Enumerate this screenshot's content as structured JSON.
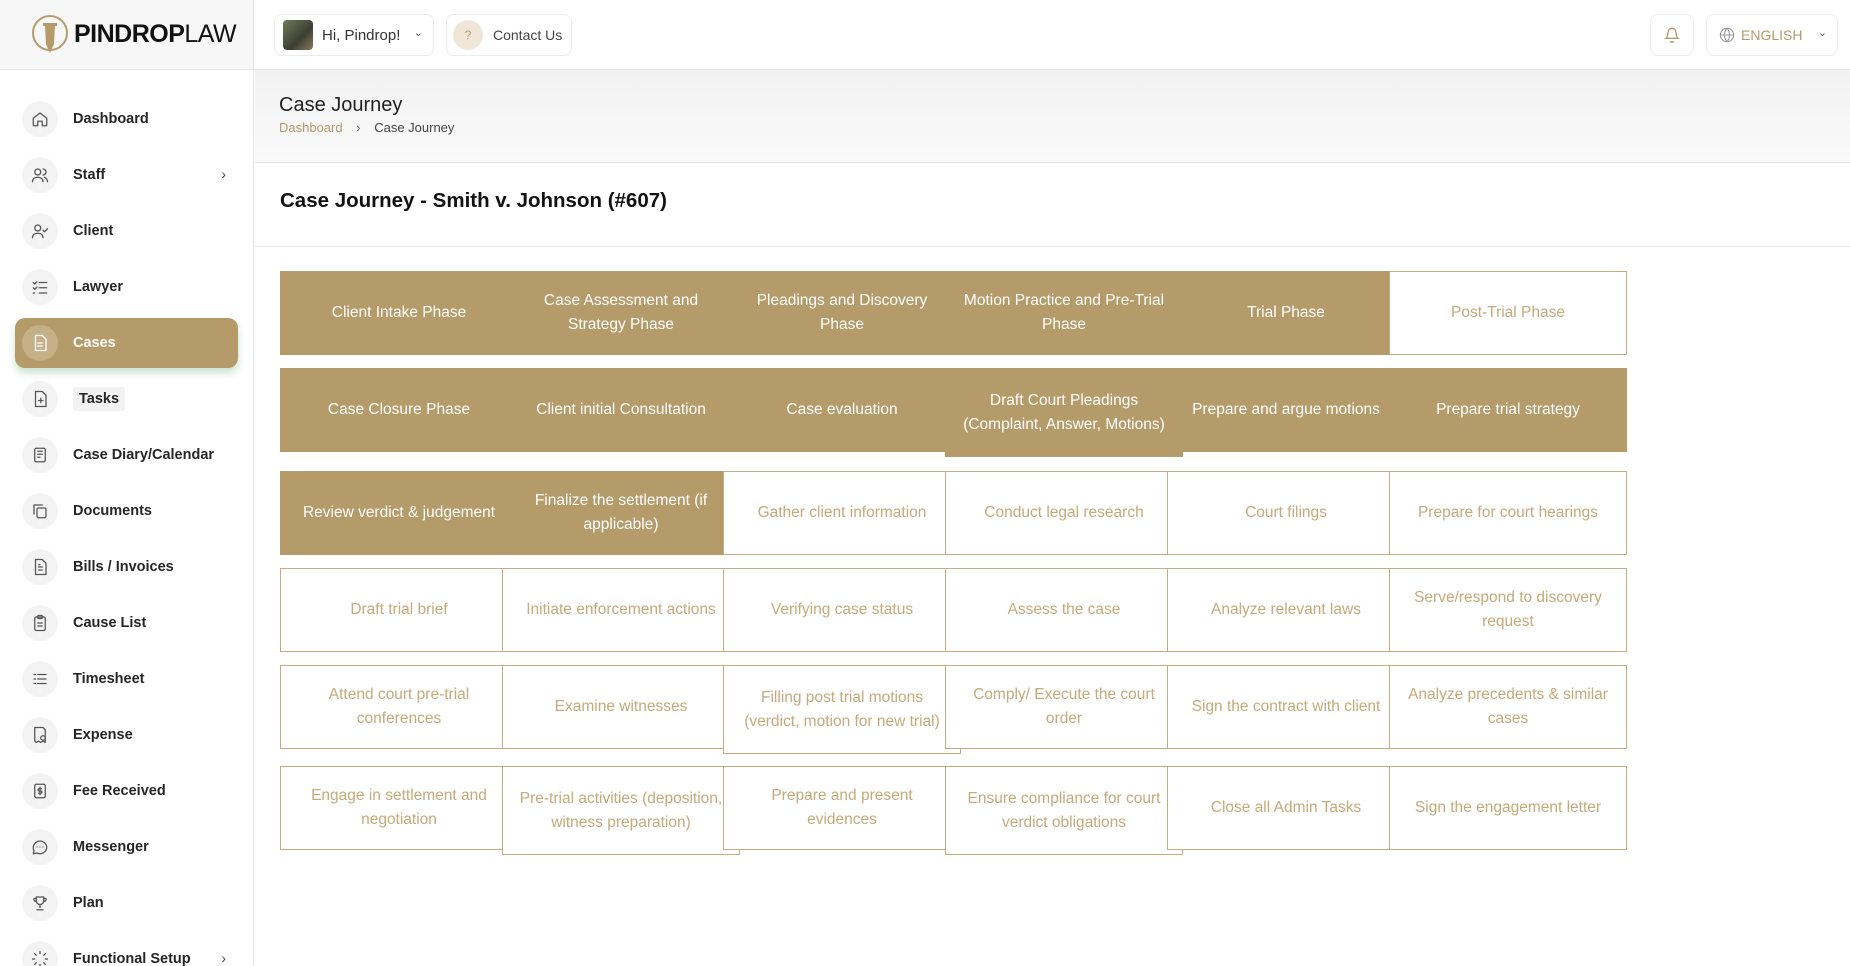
{
  "brand": {
    "bold": "PINDROP",
    "light": "LAW"
  },
  "colors": {
    "accent": "#b59b6a",
    "accent_text": "#c5aa7a"
  },
  "topbar": {
    "greeting": "Hi, Pindrop!",
    "contact": "Contact Us",
    "language": "ENGLISH"
  },
  "sidebar": {
    "items": [
      {
        "label": "Dashboard",
        "icon": "home-icon"
      },
      {
        "label": "Staff",
        "icon": "users-icon",
        "has_children": true
      },
      {
        "label": "Client",
        "icon": "user-check-icon"
      },
      {
        "label": "Lawyer",
        "icon": "list-check-icon"
      },
      {
        "label": "Cases",
        "icon": "document-icon",
        "active": true
      },
      {
        "label": "Tasks",
        "icon": "file-plus-icon"
      },
      {
        "label": "Case Diary/Calendar",
        "icon": "diary-icon"
      },
      {
        "label": "Documents",
        "icon": "copy-icon"
      },
      {
        "label": "Bills / Invoices",
        "icon": "invoice-icon"
      },
      {
        "label": "Cause List",
        "icon": "clipboard-icon"
      },
      {
        "label": "Timesheet",
        "icon": "list-icon"
      },
      {
        "label": "Expense",
        "icon": "receipt-icon"
      },
      {
        "label": "Fee Received",
        "icon": "dollar-file-icon"
      },
      {
        "label": "Messenger",
        "icon": "chat-icon"
      },
      {
        "label": "Plan",
        "icon": "trophy-icon"
      },
      {
        "label": "Functional Setup",
        "icon": "spinner-icon",
        "has_children": true
      }
    ]
  },
  "page": {
    "title": "Case Journey",
    "breadcrumb": [
      "Dashboard",
      "Case Journey"
    ],
    "section_title": "Case Journey - Smith v. Johnson (#607)"
  },
  "journey": [
    [
      {
        "label": "Client Intake Phase",
        "status": "done"
      },
      {
        "label": "Case Assessment and Strategy Phase",
        "status": "done"
      },
      {
        "label": "Pleadings and Discovery Phase",
        "status": "done"
      },
      {
        "label": "Motion Practice and Pre-Trial Phase",
        "status": "done"
      },
      {
        "label": "Trial Phase",
        "status": "done"
      },
      {
        "label": "Post-Trial Phase",
        "status": "todo"
      }
    ],
    [
      {
        "label": "Case Closure Phase",
        "status": "done"
      },
      {
        "label": "Client initial Consultation",
        "status": "done"
      },
      {
        "label": "Case evaluation",
        "status": "done"
      },
      {
        "label": "Draft Court Pleadings (Complaint, Answer, Motions)",
        "status": "done"
      },
      {
        "label": "Prepare and argue motions",
        "status": "done"
      },
      {
        "label": "Prepare trial strategy",
        "status": "done"
      }
    ],
    [
      {
        "label": "Review verdict & judgement",
        "status": "done"
      },
      {
        "label": "Finalize the settlement (if applicable)",
        "status": "done"
      },
      {
        "label": "Gather client information",
        "status": "todo"
      },
      {
        "label": "Conduct legal research",
        "status": "todo"
      },
      {
        "label": "Court filings",
        "status": "todo"
      },
      {
        "label": "Prepare for court hearings",
        "status": "todo"
      }
    ],
    [
      {
        "label": "Draft trial brief",
        "status": "todo"
      },
      {
        "label": "Initiate enforcement actions",
        "status": "todo"
      },
      {
        "label": "Verifying case status",
        "status": "todo"
      },
      {
        "label": "Assess the case",
        "status": "todo"
      },
      {
        "label": "Analyze relevant laws",
        "status": "todo"
      },
      {
        "label": "Serve/respond to discovery request",
        "status": "todo"
      }
    ],
    [
      {
        "label": "Attend court pre-trial conferences",
        "status": "todo"
      },
      {
        "label": "Examine witnesses",
        "status": "todo"
      },
      {
        "label": "Filling post trial motions (verdict, motion for new trial)",
        "status": "todo"
      },
      {
        "label": "Comply/ Execute the court order",
        "status": "todo"
      },
      {
        "label": "Sign the contract with client",
        "status": "todo"
      },
      {
        "label": "Analyze precedents & similar cases",
        "status": "todo"
      }
    ],
    [
      {
        "label": "Engage in settlement and negotiation",
        "status": "todo"
      },
      {
        "label": "Pre-trial activities (deposition, witness preparation)",
        "status": "todo"
      },
      {
        "label": "Prepare and present evidences",
        "status": "todo"
      },
      {
        "label": "Ensure compliance for court verdict obligations",
        "status": "todo"
      },
      {
        "label": "Close all Admin Tasks",
        "status": "todo"
      },
      {
        "label": "Sign the engagement letter",
        "status": "todo"
      }
    ]
  ]
}
